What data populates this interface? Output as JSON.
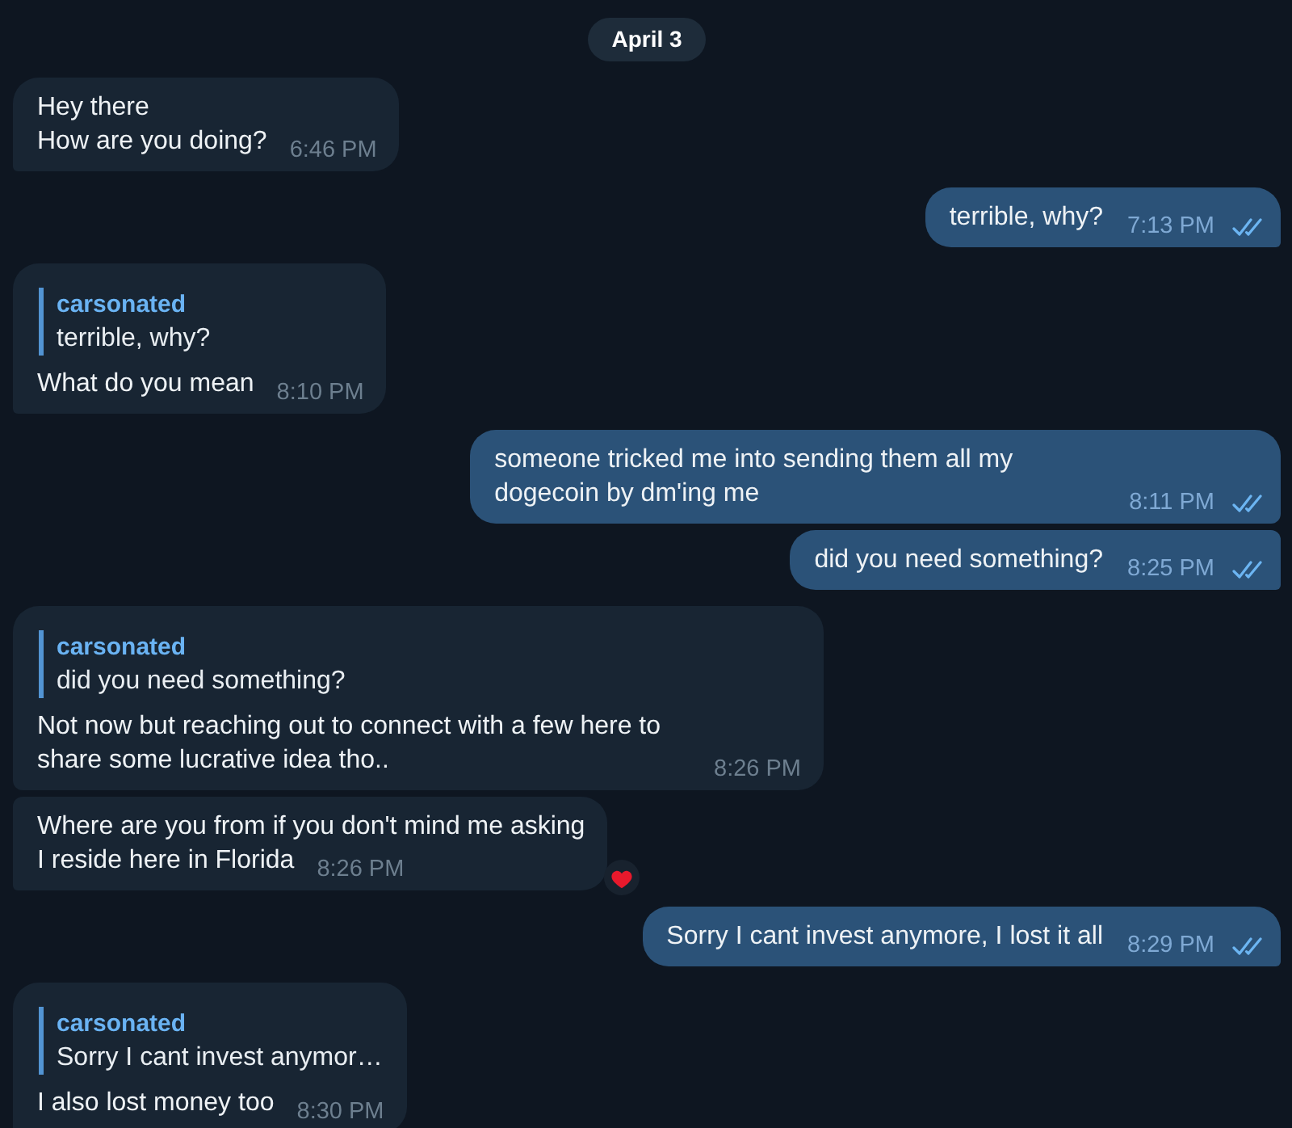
{
  "date_badge": "April 3",
  "messages": [
    {
      "kind": "incoming",
      "lines": [
        "Hey there",
        "How are you doing?"
      ],
      "time": "6:46 PM",
      "reacted": false
    },
    {
      "kind": "outgoing",
      "lines": [
        "terrible, why?"
      ],
      "time": "7:13 PM",
      "read": true,
      "reacted": false
    },
    {
      "kind": "incoming",
      "reply": {
        "name": "carsonated",
        "text": "terrible, why?"
      },
      "lines": [
        "What do you mean"
      ],
      "time": "8:10 PM",
      "reacted": false
    },
    {
      "kind": "outgoing",
      "lines": [
        "someone tricked me into sending them all my dogecoin by dm'ing me"
      ],
      "time": "8:11 PM",
      "read": true,
      "reacted": false
    },
    {
      "kind": "outgoing",
      "lines": [
        "did you need something?"
      ],
      "time": "8:25 PM",
      "read": true,
      "reacted": false
    },
    {
      "kind": "incoming",
      "reply": {
        "name": "carsonated",
        "text": "did you need something?"
      },
      "lines": [
        "Not now but reaching out to connect with a few here to share some lucrative idea tho.."
      ],
      "time": "8:26 PM",
      "reacted": false
    },
    {
      "kind": "incoming",
      "lines": [
        "Where are you from if you don't mind me asking",
        "I reside here in Florida"
      ],
      "time": "8:26 PM",
      "reacted": true
    },
    {
      "kind": "outgoing",
      "lines": [
        "Sorry I cant invest anymore, I lost it all"
      ],
      "time": "8:29 PM",
      "read": true,
      "reacted": false
    },
    {
      "kind": "incoming",
      "reply": {
        "name": "carsonated",
        "text": "Sorry I cant invest anymor…"
      },
      "lines": [
        "I also lost money too"
      ],
      "time": "8:30 PM",
      "reacted": false
    }
  ]
}
